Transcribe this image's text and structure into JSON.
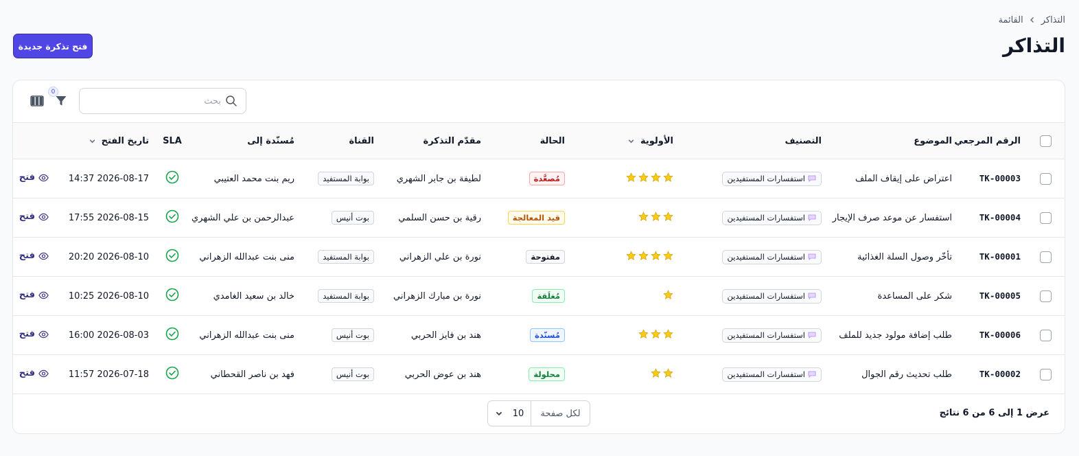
{
  "breadcrumb": {
    "items": [
      "التذاكر",
      "القائمة"
    ]
  },
  "page_title": "التذاكر",
  "new_ticket_label": "فتح تذكرة جديدة",
  "search": {
    "placeholder": "بحث",
    "value": ""
  },
  "filter_count": "0",
  "columns": {
    "ref": "الرقم المرجعي",
    "subject": "الموضوع",
    "category": "التصنيف",
    "priority": "الأولوية",
    "status": "الحالة",
    "submitter": "مقدّم التذكرة",
    "channel": "القناة",
    "assignee": "مُسنّدة إلى",
    "sla": "SLA",
    "opened_at": "تاريخ الفتح"
  },
  "rows": [
    {
      "ref": "TK-00003",
      "subject": "اعتراض على إيقاف الملف",
      "category": "استفسارات المستفيدين",
      "priority": 4,
      "status": "مُصعَّدة",
      "status_key": "escalated",
      "submitter": "لطيفة بن جابر الشهري",
      "channel": "بوابة المستفيد",
      "assignee": "ريم بنت محمد العتيبي",
      "opened_at": "2026-08-17 14:37",
      "action": "فتح"
    },
    {
      "ref": "TK-00004",
      "subject": "استفسار عن موعد صرف الإيجار",
      "category": "استفسارات المستفيدين",
      "priority": 3,
      "status": "قيد المعالجة",
      "status_key": "progress",
      "submitter": "رقية بن حسن السلمي",
      "channel": "بوت أنيس",
      "assignee": "عبدالرحمن بن علي الشهري",
      "opened_at": "2026-08-15 17:55",
      "action": "فتح"
    },
    {
      "ref": "TK-00001",
      "subject": "تأخّر وصول السلة الغذائية",
      "category": "استفسارات المستفيدين",
      "priority": 4,
      "status": "مفتوحة",
      "status_key": "open",
      "submitter": "نورة بن علي الزهراني",
      "channel": "بوابة المستفيد",
      "assignee": "منى بنت عبدالله الزهراني",
      "opened_at": "2026-08-10 20:20",
      "action": "فتح"
    },
    {
      "ref": "TK-00005",
      "subject": "شكر على المساعدة",
      "category": "استفسارات المستفيدين",
      "priority": 1,
      "status": "مُغلَقة",
      "status_key": "closed",
      "submitter": "نورة بن مبارك الزهراني",
      "channel": "بوابة المستفيد",
      "assignee": "خالد بن سعيد الغامدي",
      "opened_at": "2026-08-10 10:25",
      "action": "فتح"
    },
    {
      "ref": "TK-00006",
      "subject": "طلب إضافة مولود جديد للملف",
      "category": "استفسارات المستفيدين",
      "priority": 3,
      "status": "مُسنّدة",
      "status_key": "assigned",
      "submitter": "هند بن فايز الحربي",
      "channel": "بوت أنيس",
      "assignee": "منى بنت عبدالله الزهراني",
      "opened_at": "2026-08-03 16:00",
      "action": "فتح"
    },
    {
      "ref": "TK-00002",
      "subject": "طلب تحديث رقم الجوال",
      "category": "استفسارات المستفيدين",
      "priority": 2,
      "status": "محلولة",
      "status_key": "resolved",
      "submitter": "هند بن عوض الحربي",
      "channel": "بوت أنيس",
      "assignee": "فهد بن ناصر القحطاني",
      "opened_at": "2026-07-18 11:57",
      "action": "فتح"
    }
  ],
  "status_colors": {
    "escalated": {
      "text": "#b91c1c",
      "bg": "#fef2f2",
      "border": "#fca5a5"
    },
    "progress": {
      "text": "#b45309",
      "bg": "#fffbeb",
      "border": "#fcd34d"
    },
    "open": {
      "text": "#111827",
      "bg": "#f9fafb",
      "border": "#d1d5db"
    },
    "closed": {
      "text": "#15803d",
      "bg": "#f0fdf4",
      "border": "#86efac"
    },
    "assigned": {
      "text": "#1d4ed8",
      "bg": "#eff6ff",
      "border": "#93c5fd"
    },
    "resolved": {
      "text": "#15803d",
      "bg": "#f0fdf4",
      "border": "#86efac"
    }
  },
  "colors": {
    "accent": "#4f46e5",
    "sla_ok": "#16a34a",
    "star": "#facc15"
  },
  "icons": {
    "breadcrumb_sep": "chevron-icon",
    "search": "search-icon",
    "filter": "filter-icon",
    "columns": "columns-icon",
    "category": "chat-bubble-icon",
    "priority": "star-icon",
    "sla": "check-circle-icon",
    "action": "eye-icon",
    "sort": "chevron-down-icon"
  },
  "footer": {
    "summary": "عرض 1 إلى 6 من 6 نتائج",
    "per_page_label": "لكل صفحة",
    "per_page_value": "10"
  }
}
